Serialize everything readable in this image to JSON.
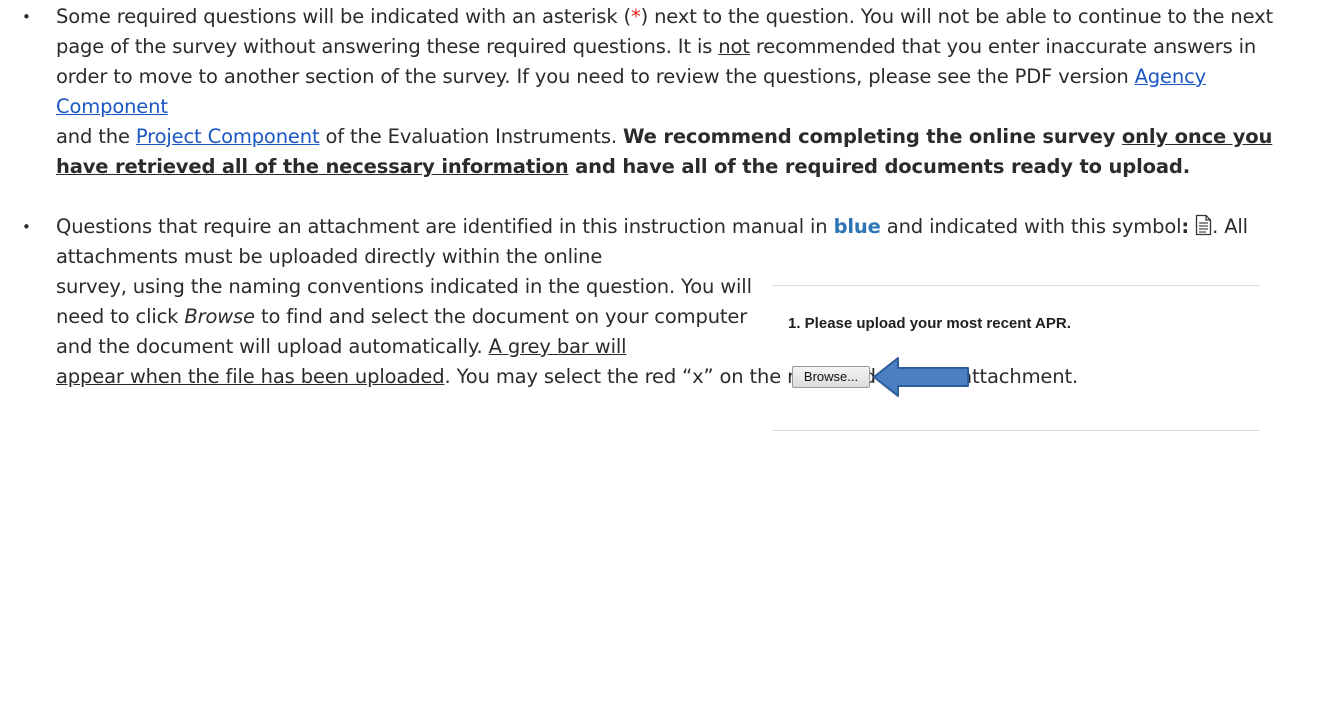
{
  "bullet1": {
    "bullet": "•",
    "t1": "Some required questions will be indicated with an asterisk (",
    "asterisk": "*",
    "t2": ") next to the question. You will not be able to continue to the next page of the survey without answering these required questions. It is ",
    "not": "not",
    "t3": " recommended that you enter inaccurate answers in order to move to another section of the survey. If you need to review the questions, please see the PDF version ",
    "link1": "Agency Component",
    "t4": " and the ",
    "link2": "Project Component",
    "t5": " of the Evaluation Instruments. ",
    "b1": "We recommend completing the online survey ",
    "bu": "only once you have retrieved all of the necessary information",
    "b2": " and have all of the required documents ready to upload."
  },
  "bullet2": {
    "bullet": "•",
    "t1": "Questions that require an attachment are identified in this instruction manual in ",
    "blue": "blue",
    "t2": " and indicated with this symbol",
    "colon": ":",
    "t3": ". All attachments must be uploaded directly within the online",
    "t4": "survey, using the naming conventions indicated in the question. You will need to click ",
    "browse_italic": "Browse",
    "t5": " to find and select the document on your computer and the document will upload automatically. ",
    "u1": "A grey bar will",
    "u2": "appear when the file has been uploaded",
    "t6": ". You may select the red “x” on the right to delete an attachment."
  },
  "figure": {
    "title": "1. Please upload your most recent APR.",
    "button": "Browse..."
  },
  "colors": {
    "asterisk": "#e02020",
    "link": "#1a56c4",
    "blue_word": "#2e75b6",
    "arrow_fill": "#4a7fc1",
    "arrow_stroke": "#2f5e9c"
  }
}
